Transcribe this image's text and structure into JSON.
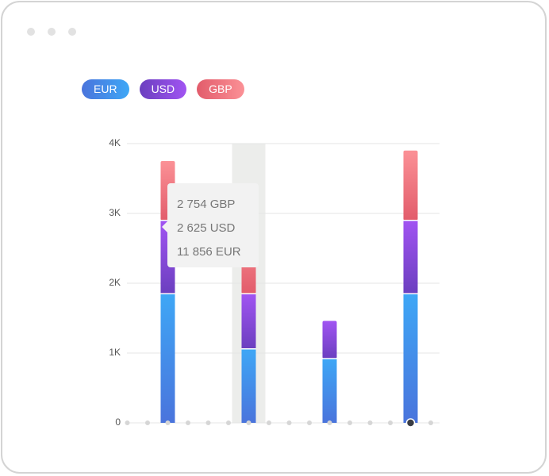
{
  "legend": [
    {
      "label": "EUR",
      "key": "eur"
    },
    {
      "label": "USD",
      "key": "usd"
    },
    {
      "label": "GBP",
      "key": "gbp"
    }
  ],
  "tooltip": {
    "lines": [
      "2 754 GBP",
      "2 625 USD",
      "11 856 EUR"
    ]
  },
  "colors": {
    "eur_top": "#3ea7f6",
    "eur_bottom": "#4a74dc",
    "usd_top": "#a154f2",
    "usd_bottom": "#6b3fbf",
    "gbp_top": "#fb9196",
    "gbp_bottom": "#e25c6b",
    "highlight": "#ecedeb",
    "grid": "#e5e5e5"
  },
  "chart_data": {
    "type": "bar",
    "stacked": true,
    "ylim": [
      0,
      4000
    ],
    "yticks": [
      {
        "value": 0,
        "label": "0"
      },
      {
        "value": 1000,
        "label": "1K"
      },
      {
        "value": 2000,
        "label": "2K"
      },
      {
        "value": 3000,
        "label": "3K"
      },
      {
        "value": 4000,
        "label": "4K"
      }
    ],
    "x_positions": 16,
    "highlighted_index": 5,
    "active_index": 13,
    "bars": [
      {
        "index": 1,
        "EUR": 1850,
        "USD": 1050,
        "GBP": 850
      },
      {
        "index": 5,
        "EUR": 1060,
        "USD": 790,
        "GBP": 1000
      },
      {
        "index": 9,
        "EUR": 920,
        "USD": 540,
        "GBP": 0
      },
      {
        "index": 13,
        "EUR": 1850,
        "USD": 1050,
        "GBP": 1000
      }
    ],
    "series": [
      {
        "name": "EUR"
      },
      {
        "name": "USD"
      },
      {
        "name": "GBP"
      }
    ],
    "grid": true,
    "legend_position": "top-left"
  }
}
